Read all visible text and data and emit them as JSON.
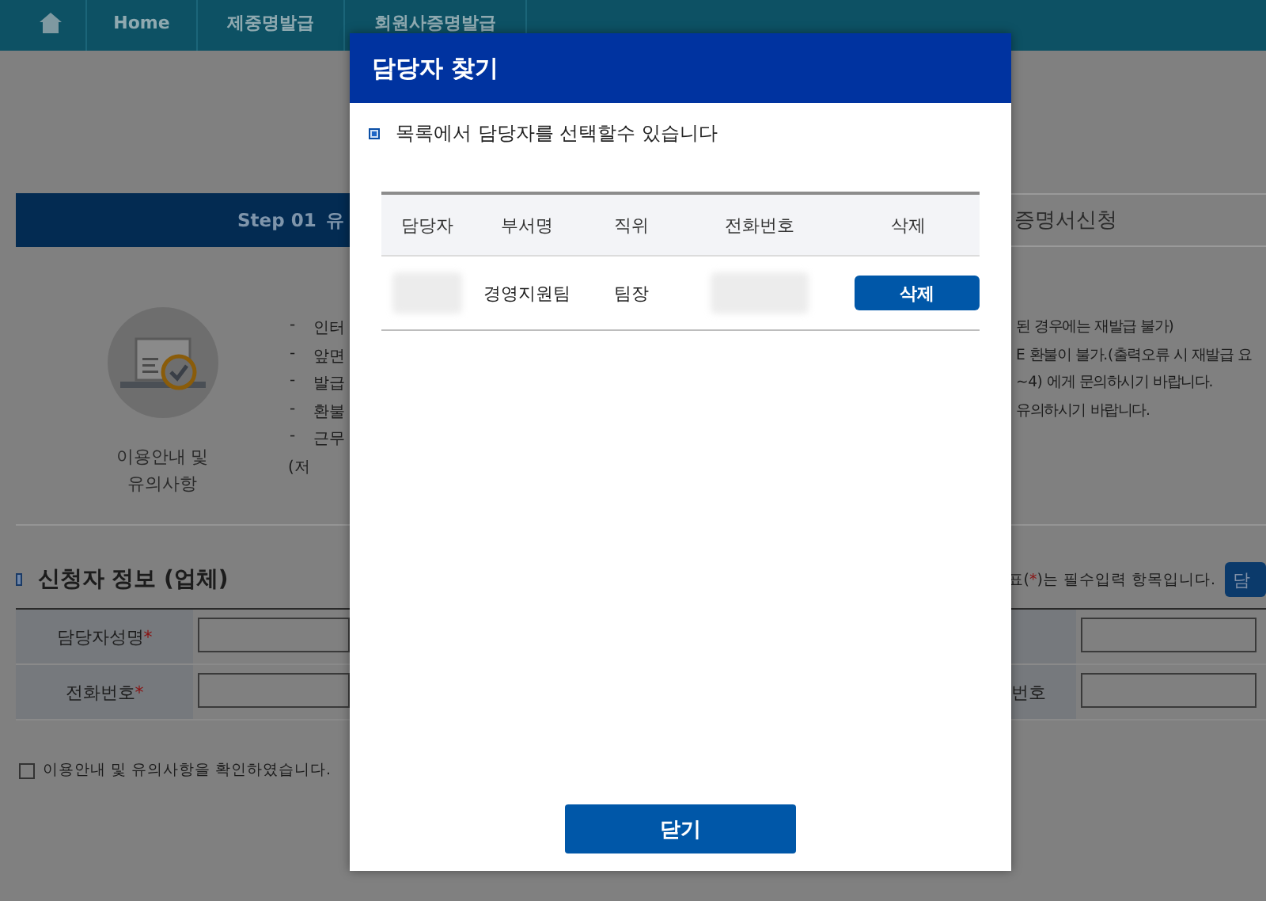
{
  "nav": {
    "items": [
      {
        "kind": "home"
      },
      {
        "kind": "text",
        "label": "Home"
      },
      {
        "kind": "text",
        "label": "제중명발급"
      },
      {
        "kind": "text",
        "label": "회원사증명발급"
      }
    ]
  },
  "step_bar": {
    "step": "Step 01",
    "title_fragment": "유",
    "right_fragment": "증명서신청"
  },
  "guide": {
    "icon_label": "이용안내 및\n유의사항",
    "left_items": [
      {
        "kind": "bullet",
        "dash": "-",
        "text": "인터"
      },
      {
        "kind": "bullet",
        "dash": "-",
        "text": "앞면"
      },
      {
        "kind": "bullet",
        "dash": "-",
        "text": "발급"
      },
      {
        "kind": "bullet",
        "dash": "-",
        "text": "환불"
      },
      {
        "kind": "bullet",
        "dash": "-",
        "text": "근무"
      },
      {
        "kind": "continuation",
        "text": "(저"
      }
    ],
    "right_lines": [
      "된 경우에는 재발급 불가)",
      "E 환불이 불가.(출력오류 시 재발급 요",
      "~4) 에게 문의하시기 바랍니다.",
      "유의하시기 바랍니다."
    ]
  },
  "applicant": {
    "title": "신청자 정보 (업체)",
    "note": {
      "before": "표(",
      "mark": "*",
      "after": ")는 필수입력 항목입니다."
    },
    "button": "담",
    "rows": [
      {
        "label": "담당자성명",
        "mark": "*"
      },
      {
        "label": "전화번호",
        "mark": "*",
        "right_label": "번호"
      }
    ]
  },
  "agree": {
    "checked": false,
    "label": "이용안내 및 유의사항을 확인하였습니다."
  },
  "dialog": {
    "title": "담당자 찾기",
    "notice": "목록에서 담당자를 선택할수 있습니다",
    "columns": [
      "담당자",
      "부서명",
      "직위",
      "전화번호",
      "삭제"
    ],
    "rows": [
      {
        "cells": [
          {
            "kind": "blurred"
          },
          {
            "kind": "text",
            "text": "경영지원팀"
          },
          {
            "kind": "text",
            "text": "팀장"
          },
          {
            "kind": "blurred"
          },
          {
            "kind": "button",
            "text": "삭제"
          }
        ]
      }
    ],
    "close": "닫기"
  }
}
